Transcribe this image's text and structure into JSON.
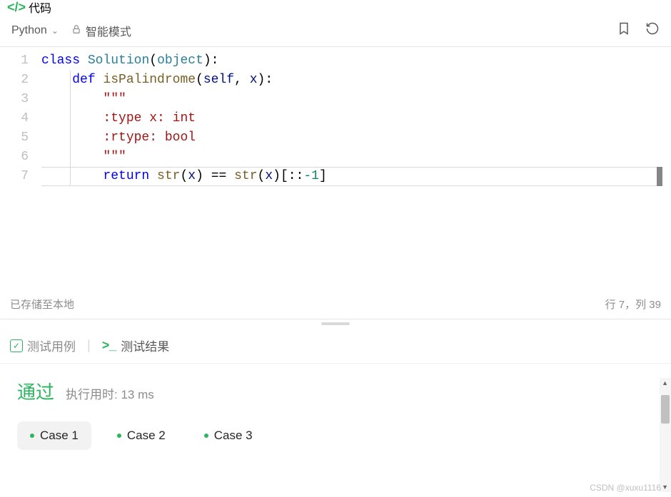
{
  "header": {
    "title": "代码"
  },
  "toolbar": {
    "language": "Python",
    "smart_mode_label": "智能模式"
  },
  "code": {
    "lines": [
      "1",
      "2",
      "3",
      "4",
      "5",
      "6",
      "7"
    ]
  },
  "status": {
    "saved_text": "已存储至本地",
    "cursor_position": "行 7，列 39"
  },
  "tabs": {
    "test_cases": "测试用例",
    "test_results": "测试结果"
  },
  "result": {
    "status": "通过",
    "runtime_label": "执行用时: ",
    "runtime_value": "13 ms"
  },
  "cases": [
    {
      "label": "Case 1",
      "active": true
    },
    {
      "label": "Case 2",
      "active": false
    },
    {
      "label": "Case 3",
      "active": false
    }
  ],
  "watermark": "CSDN @xuxu1116",
  "chart_data": {
    "type": "code",
    "language": "Python",
    "source": "class Solution(object):\n    def isPalindrome(self, x):\n        \"\"\"\n        :type x: int\n        :rtype: bool\n        \"\"\"\n        return str(x) == str(x)[::-1]"
  }
}
